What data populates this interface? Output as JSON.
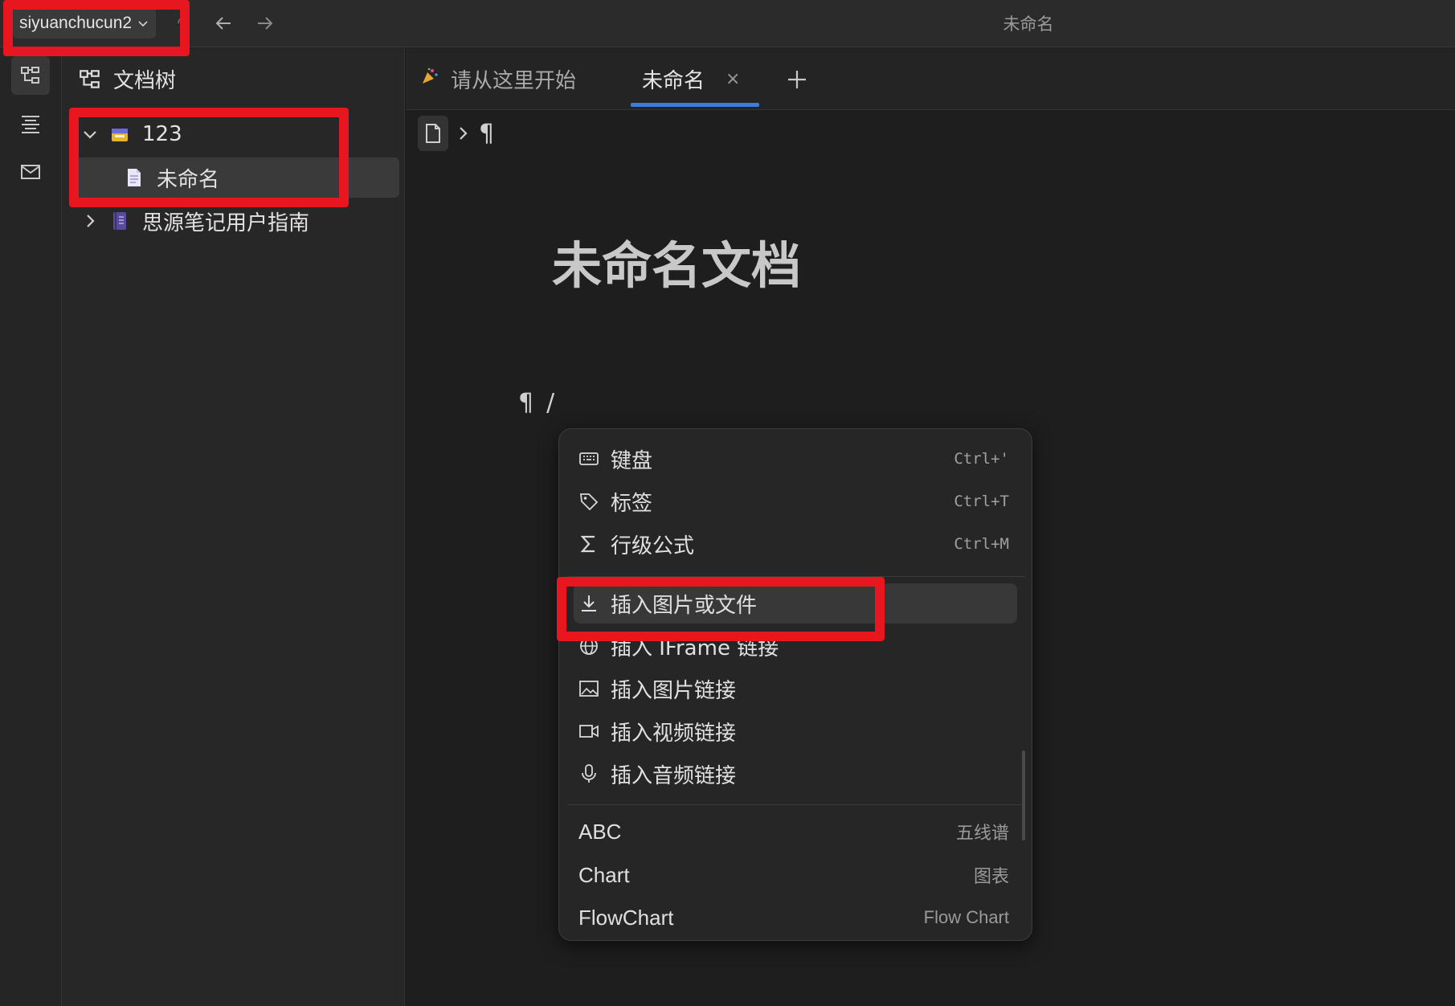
{
  "topbar": {
    "workspace": "siyuanchucun2",
    "doc_title": "未命名"
  },
  "tree": {
    "header": "文档树",
    "items": [
      {
        "label": "123",
        "level": 0,
        "expanded": true,
        "emoji": "notebook"
      },
      {
        "label": "未命名",
        "level": 1,
        "selected": true,
        "emoji": "document"
      },
      {
        "label": "思源笔记用户指南",
        "level": 0,
        "expanded": false,
        "emoji": "notebook-purple"
      }
    ]
  },
  "tabs": [
    {
      "label": "请从这里开始",
      "active": false
    },
    {
      "label": "未命名",
      "active": true,
      "close": "×"
    }
  ],
  "editor": {
    "breadcrumb_symbol": "¶",
    "title": "未命名文档",
    "para_symbol": "¶",
    "typed_text": "/"
  },
  "menu": {
    "items": [
      {
        "icon": "keyboard-icon",
        "label": "键盘",
        "shortcut": "Ctrl+'"
      },
      {
        "icon": "tag-icon",
        "label": "标签",
        "shortcut": "Ctrl+T"
      },
      {
        "icon": "sigma-icon",
        "label": "行级公式",
        "shortcut": "Ctrl+M"
      },
      {
        "icon": "download-icon",
        "label": "插入图片或文件",
        "highlighted": true
      },
      {
        "icon": "globe-icon",
        "label": "插入 IFrame 链接"
      },
      {
        "icon": "image-icon",
        "label": "插入图片链接"
      },
      {
        "icon": "video-icon",
        "label": "插入视频链接"
      },
      {
        "icon": "mic-icon",
        "label": "插入音频链接"
      },
      {
        "label": "ABC",
        "hint": "五线谱"
      },
      {
        "label": "Chart",
        "hint": "图表"
      },
      {
        "label": "FlowChart",
        "hint": "Flow Chart"
      }
    ]
  },
  "colors": {
    "annotation_red": "#e8171f",
    "tab_accent": "#3b7ddd"
  }
}
